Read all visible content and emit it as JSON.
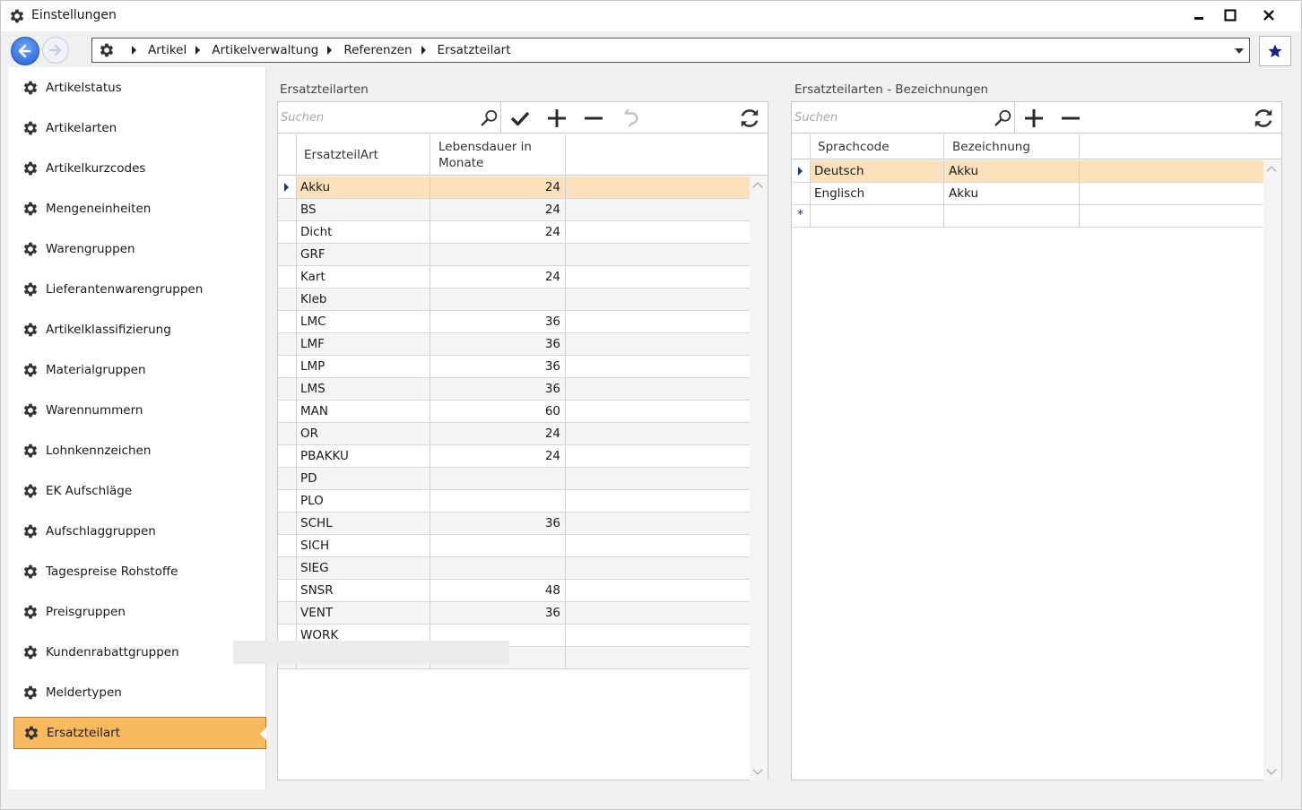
{
  "window": {
    "title": "Einstellungen"
  },
  "breadcrumb": [
    "Artikel",
    "Artikelverwaltung",
    "Referenzen",
    "Ersatzteilart"
  ],
  "sidebar": {
    "items": [
      "Artikelstatus",
      "Artikelarten",
      "Artikelkurzcodes",
      "Mengeneinheiten",
      "Warengruppen",
      "Lieferantenwarengruppen",
      "Artikelklassifizierung",
      "Materialgruppen",
      "Warennummern",
      "Lohnkennzeichen",
      "EK Aufschläge",
      "Aufschlaggruppen",
      "Tagespreise Rohstoffe",
      "Preisgruppen",
      "Kundenrabattgruppen",
      "Meldertypen",
      "Ersatzteilart"
    ],
    "active": "Ersatzteilart"
  },
  "left_panel": {
    "title": "Ersatzteilarten",
    "search_placeholder": "Suchen",
    "columns": [
      "ErsatzteilArt",
      "Lebensdauer in Monate"
    ],
    "rows": [
      [
        "Akku",
        "24"
      ],
      [
        "BS",
        "24"
      ],
      [
        "Dicht",
        "24"
      ],
      [
        "GRF",
        ""
      ],
      [
        "Kart",
        "24"
      ],
      [
        "Kleb",
        ""
      ],
      [
        "LMC",
        "36"
      ],
      [
        "LMF",
        "36"
      ],
      [
        "LMP",
        "36"
      ],
      [
        "LMS",
        "36"
      ],
      [
        "MAN",
        "60"
      ],
      [
        "OR",
        "24"
      ],
      [
        "PBAKKU",
        "24"
      ],
      [
        "PD",
        ""
      ],
      [
        "PLO",
        ""
      ],
      [
        "SCHL",
        "36"
      ],
      [
        "SICH",
        ""
      ],
      [
        "SIEG",
        ""
      ],
      [
        "SNSR",
        "48"
      ],
      [
        "VENT",
        "36"
      ],
      [
        "WORK",
        ""
      ],
      [
        "",
        ""
      ]
    ],
    "selected_row": 0
  },
  "right_panel": {
    "title": "Ersatzteilarten - Bezeichnungen",
    "search_placeholder": "Suchen",
    "columns": [
      "Sprachcode",
      "Bezeichnung"
    ],
    "rows": [
      [
        "Deutsch",
        "Akku"
      ],
      [
        "Englisch",
        "Akku"
      ]
    ],
    "selected_row": 0,
    "new_row_marker": "*"
  },
  "colors": {
    "active_item": "#f9b95f",
    "selected_row": "#fde1bd",
    "favorite_star": "#1a237e",
    "back_button": "#1f5fd6"
  },
  "icons": {
    "title": "gear-icon",
    "toolbar_left": [
      "search-icon",
      "check-icon",
      "plus-icon",
      "minus-icon",
      "undo-icon",
      "refresh-icon"
    ],
    "toolbar_right": [
      "search-icon",
      "plus-icon",
      "minus-icon",
      "refresh-icon"
    ]
  }
}
